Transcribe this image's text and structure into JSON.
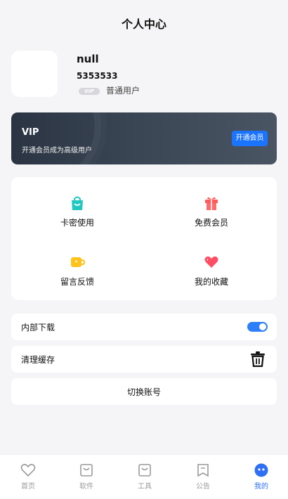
{
  "header": {
    "title": "个人中心"
  },
  "profile": {
    "username": "null",
    "user_id": "5353533",
    "vip_badge": "VIP",
    "user_type": "普通用户"
  },
  "vip_card": {
    "title": "VIP",
    "subtitle": "开通会员成为高级用户",
    "button_label": "开通会员"
  },
  "grid": {
    "items": [
      {
        "label": "卡密使用",
        "icon": "shopping-bag-icon",
        "color": "#22c8c0"
      },
      {
        "label": "免费会员",
        "icon": "gift-icon",
        "color": "#ff5a5a"
      },
      {
        "label": "留言反馈",
        "icon": "coffee-cup-icon",
        "color": "#ffc21a"
      },
      {
        "label": "我的收藏",
        "icon": "heart-icon",
        "color": "#ff4d63"
      }
    ]
  },
  "settings": {
    "internal_download": {
      "label": "内部下载",
      "enabled": true
    },
    "clear_cache": {
      "label": "清理缓存"
    },
    "switch_account": {
      "label": "切换账号"
    }
  },
  "tabbar": {
    "items": [
      {
        "label": "首页",
        "icon": "heart-outline-icon",
        "active": false
      },
      {
        "label": "软件",
        "icon": "bag-outline-icon",
        "active": false
      },
      {
        "label": "工具",
        "icon": "bag-outline-icon",
        "active": false
      },
      {
        "label": "公告",
        "icon": "bookmark-outline-icon",
        "active": false
      },
      {
        "label": "我的",
        "icon": "profile-face-icon",
        "active": true
      }
    ]
  },
  "colors": {
    "accent": "#2f6ff5",
    "toggle_on": "#2d7ff9",
    "vip_button": "#1b74ff"
  }
}
